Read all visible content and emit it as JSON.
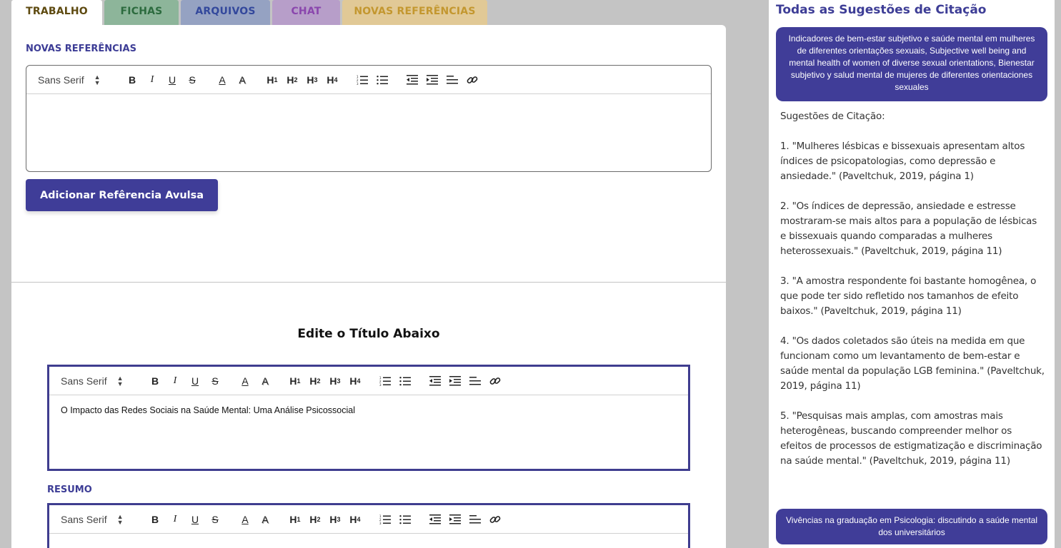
{
  "tabs": [
    {
      "label": "TRABALHO"
    },
    {
      "label": "FICHAS"
    },
    {
      "label": "ARQUIVOS"
    },
    {
      "label": "CHAT"
    },
    {
      "label": "NOVAS REFERÊNCIAS"
    }
  ],
  "upper": {
    "section_label": "NOVAS REFERÊNCIAS",
    "editor_value": "",
    "add_button": "Adicionar Refêrencia Avulsa"
  },
  "toolbar": {
    "font": "Sans Serif",
    "bold": "B",
    "italic": "I",
    "underline": "U",
    "strike": "S",
    "color": "A",
    "background": "A",
    "h1": "H",
    "h2": "H",
    "h3": "H",
    "h4": "H",
    "n1": "1",
    "n2": "2",
    "n3": "3",
    "n4": "4"
  },
  "lower": {
    "edit_title_heading": "Edite o Título Abaixo",
    "title_value": "O Impacto das Redes Sociais na Saúde Mental: Uma Análise Psicossocial",
    "resumo_label": "RESUMO",
    "resumo_value": ""
  },
  "sidebar": {
    "title": "Todas as Sugestões de Citação",
    "source1": "Indicadores de bem-estar subjetivo e saúde mental em mulheres de diferentes orientações sexuais, Subjective well being and mental health of women of diverse sexual orientations, Bienestar subjetivo y salud mental de mujeres de diferentes orientaciones sexuales",
    "citations": {
      "heading": "Sugestões de Citação:",
      "c1": "1. \"Mulheres lésbicas e bissexuais apresentam altos índices de psicopatologias, como depressão e ansiedade.\" (Paveltchuk, 2019, página 1)",
      "c2": "2. \"Os índices de depressão, ansiedade e estresse mostraram-se mais altos para a população de lésbicas e bissexuais quando comparadas a mulheres heterossexuais.\" (Paveltchuk, 2019, página 11)",
      "c3": "3. \"A amostra respondente foi bastante homogênea, o que pode ter sido refletido nos tamanhos de efeito baixos.\" (Paveltchuk, 2019, página 11)",
      "c4": "4. \"Os dados coletados são úteis na medida em que funcionam como um levantamento de bem-estar e saúde mental da população LGB feminina.\" (Paveltchuk, 2019, página 11)",
      "c5": "5. \"Pesquisas mais amplas, com amostras mais heterogêneas, buscando compreender melhor os efeitos de processos de estigmatização e discriminação na saúde mental.\" (Paveltchuk, 2019, página 11)"
    },
    "source2": "Vivências na graduação em Psicologia: discutindo a saúde mental dos universitários"
  },
  "colors": {
    "accent": "#3f3d98",
    "background": "#c4c4c4"
  }
}
